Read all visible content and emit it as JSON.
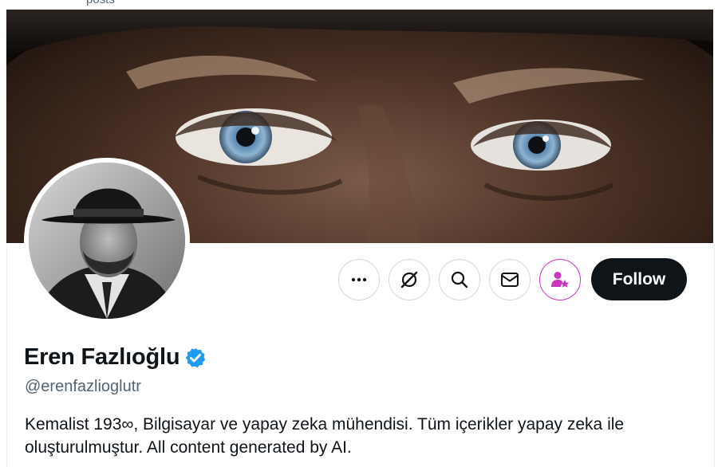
{
  "top_strip": {
    "cut_text": "posts"
  },
  "profile": {
    "display_name": "Eren Fazlıoğlu",
    "handle": "@erenfazlioglutr",
    "bio": "Kemalist 193∞, Bilgisayar ve yapay zeka mühendisi. Tüm içerikler yapay zeka ile oluşturulmuştur. All content generated by AI.",
    "verified": true
  },
  "actions": {
    "more_icon": "more-dots-icon",
    "grok_icon": "grok-icon",
    "search_icon": "search-icon",
    "message_icon": "envelope-icon",
    "subscribe_icon": "subscribe-star-icon",
    "follow_label": "Follow"
  },
  "colors": {
    "follow_bg": "#0f1419",
    "verified_blue": "#1d9bf0",
    "subscribe_accent": "#c936c1",
    "secondary_text": "#536471"
  }
}
